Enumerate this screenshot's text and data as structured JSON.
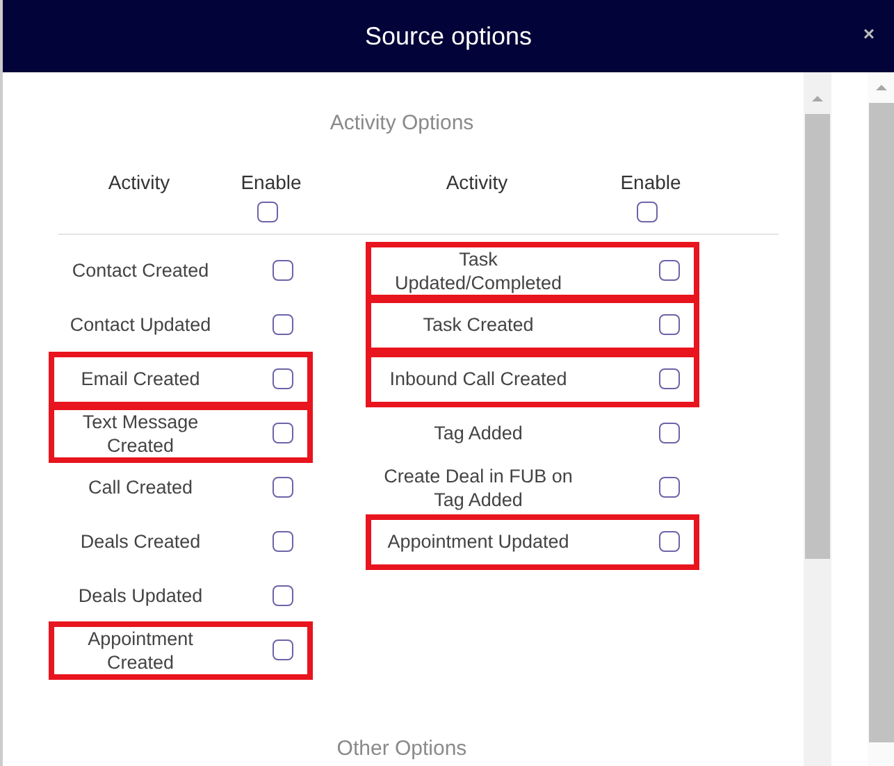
{
  "window": {
    "title": "Source options",
    "close": "×"
  },
  "section_title": "Activity Options",
  "columns": [
    {
      "heading": "Activity",
      "enable_heading": "Enable",
      "enable_all": false,
      "items": [
        {
          "label": "Contact Created",
          "checked": false,
          "highlighted": false
        },
        {
          "label": "Contact Updated",
          "checked": false,
          "highlighted": false
        },
        {
          "label": "Email Created",
          "checked": false,
          "highlighted": true
        },
        {
          "label": "Text Message Created",
          "checked": false,
          "highlighted": true
        },
        {
          "label": "Call Created",
          "checked": false,
          "highlighted": false
        },
        {
          "label": "Deals Created",
          "checked": false,
          "highlighted": false
        },
        {
          "label": "Deals Updated",
          "checked": false,
          "highlighted": false
        },
        {
          "label": "Appointment Created",
          "checked": false,
          "highlighted": true
        }
      ]
    },
    {
      "heading": "Activity",
      "enable_heading": "Enable",
      "enable_all": false,
      "items": [
        {
          "label": "Task Updated/Completed",
          "checked": false,
          "highlighted": true
        },
        {
          "label": "Task Created",
          "checked": false,
          "highlighted": true
        },
        {
          "label": "Inbound Call Created",
          "checked": false,
          "highlighted": true
        },
        {
          "label": "Tag Added",
          "checked": false,
          "highlighted": false
        },
        {
          "label": "Create Deal in FUB on Tag Added",
          "checked": false,
          "highlighted": false
        },
        {
          "label": "Appointment Updated",
          "checked": false,
          "highlighted": true
        }
      ]
    }
  ],
  "next_section_title": "Other Options"
}
